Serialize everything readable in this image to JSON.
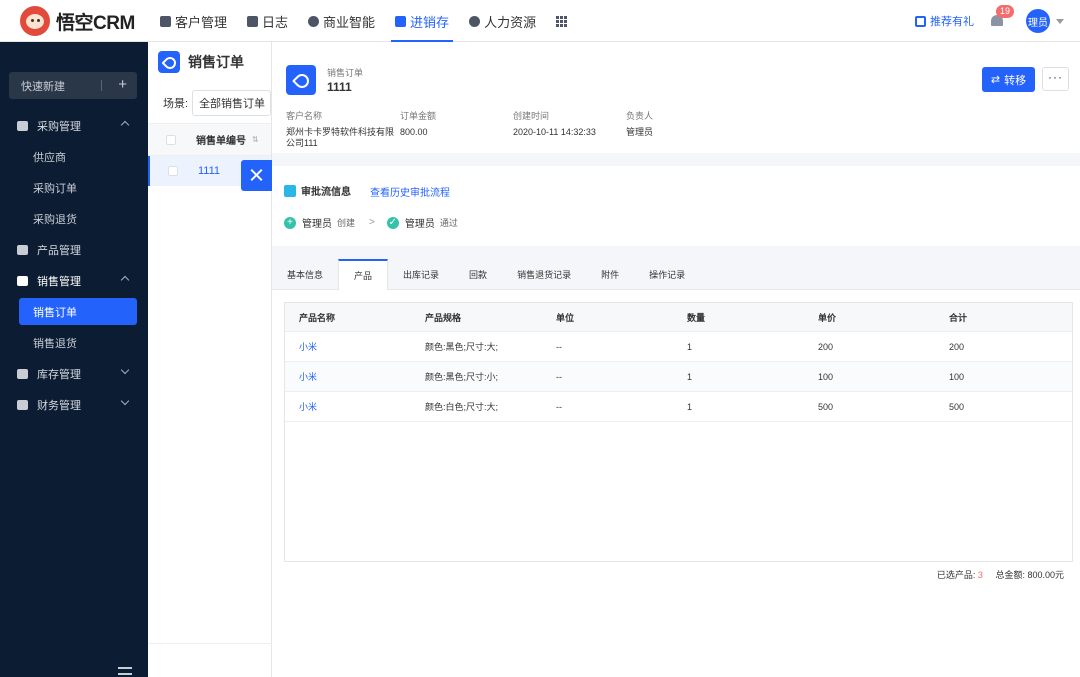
{
  "header": {
    "logo_text": "悟空CRM",
    "nav": [
      {
        "label": "客户管理",
        "icon": "customer-icon"
      },
      {
        "label": "日志",
        "icon": "log-icon"
      },
      {
        "label": "商业智能",
        "icon": "bi-icon"
      },
      {
        "label": "进销存",
        "icon": "inventory-icon",
        "active": true
      },
      {
        "label": "人力资源",
        "icon": "hr-icon"
      }
    ],
    "gift_label": "推荐有礼",
    "bell_count": "19",
    "avatar_text": "理员"
  },
  "sidebar": {
    "quick_new": "快速新建",
    "menu": {
      "purchase": "采购管理",
      "supplier": "供应商",
      "purchase_order": "采购订单",
      "purchase_return": "采购退货",
      "product": "产品管理",
      "sales": "销售管理",
      "sales_order": "销售订单",
      "sales_return": "销售退货",
      "stock": "库存管理",
      "finance": "财务管理"
    }
  },
  "listpanel": {
    "title": "销售订单",
    "scene_label": "场景:",
    "scene_value": "全部销售订单",
    "col_header": "销售单编号",
    "row_value": "1111"
  },
  "detail": {
    "type_label": "销售订单",
    "name": "1111",
    "transfer_label": "转移",
    "more_label": "···",
    "fields": {
      "customer_key": "客户名称",
      "customer_val": "郑州卡卡罗特软件科技有限公司111",
      "amount_key": "订单金额",
      "amount_val": "800.00",
      "created_key": "创建时间",
      "created_val": "2020-10-11 14:32:33",
      "owner_key": "负责人",
      "owner_val": "管理员"
    },
    "flow": {
      "title": "审批流信息",
      "history_link": "查看历史审批流程",
      "step1_name": "管理员",
      "step1_action": "创建",
      "step2_name": "管理员",
      "step2_action": "通过"
    },
    "tabs": [
      "基本信息",
      "产品",
      "出库记录",
      "回款",
      "销售退货记录",
      "附件",
      "操作记录"
    ],
    "active_tab": "产品",
    "table": {
      "headers": [
        "产品名称",
        "产品规格",
        "单位",
        "数量",
        "单价",
        "合计"
      ],
      "rows": [
        [
          "小米",
          "颜色:黑色;尺寸:大;",
          "--",
          "1",
          "200",
          "200"
        ],
        [
          "小米",
          "颜色:黑色;尺寸:小;",
          "--",
          "1",
          "100",
          "100"
        ],
        [
          "小米",
          "颜色:白色;尺寸:大;",
          "--",
          "1",
          "500",
          "500"
        ]
      ]
    },
    "summary": {
      "selected_label": "已选产品:",
      "selected_count": "3",
      "total_label": "总金额:",
      "total_value": "800.00元"
    }
  },
  "colors": {
    "primary": "#2362fb",
    "sidebar_bg": "#0c1c32",
    "badge_red": "#f56c6c",
    "step_green": "#35c2a8"
  }
}
